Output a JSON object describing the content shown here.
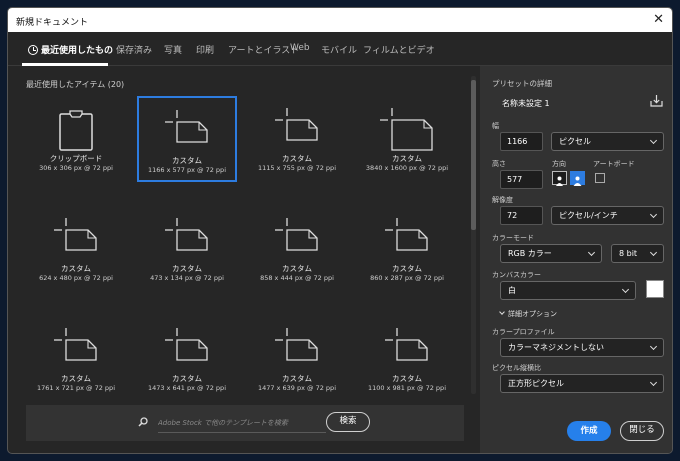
{
  "window": {
    "title": "新規ドキュメント",
    "close": "✕"
  },
  "tabs": [
    {
      "label": "最近使用したもの"
    },
    {
      "label": "保存済み"
    },
    {
      "label": "写真"
    },
    {
      "label": "印刷"
    },
    {
      "label": "アートとイラスト"
    },
    {
      "label": "Web"
    },
    {
      "label": "モバイル"
    },
    {
      "label": "フィルムとビデオ"
    }
  ],
  "recent": {
    "title": "最近使用したアイテム (20)",
    "items": [
      {
        "name": "クリップボード",
        "size": "306 x 306 px @ 72 ppi",
        "icon": "clipboard-icon"
      },
      {
        "name": "カスタム",
        "size": "1166 x 577 px @ 72 ppi",
        "icon": "custom-doc-icon"
      },
      {
        "name": "カスタム",
        "size": "1115 x 755 px @ 72 ppi",
        "icon": "custom-doc-icon"
      },
      {
        "name": "カスタム",
        "size": "3840 x 1600 px @ 72 ppi",
        "icon": "custom-doc-icon"
      },
      {
        "name": "カスタム",
        "size": "624 x 480 px @ 72 ppi",
        "icon": "custom-doc-icon"
      },
      {
        "name": "カスタム",
        "size": "473 x 134 px @ 72 ppi",
        "icon": "custom-doc-icon"
      },
      {
        "name": "カスタム",
        "size": "858 x 444 px @ 72 ppi",
        "icon": "custom-doc-icon"
      },
      {
        "name": "カスタム",
        "size": "860 x 287 px @ 72 ppi",
        "icon": "custom-doc-icon"
      },
      {
        "name": "カスタム",
        "size": "1761 x 721 px @ 72 ppi",
        "icon": "custom-doc-icon"
      },
      {
        "name": "カスタム",
        "size": "1473 x 641 px @ 72 ppi",
        "icon": "custom-doc-icon"
      },
      {
        "name": "カスタム",
        "size": "1477 x 639 px @ 72 ppi",
        "icon": "custom-doc-icon"
      },
      {
        "name": "カスタム",
        "size": "1100 x 981 px @ 72 ppi",
        "icon": "custom-doc-icon"
      }
    ]
  },
  "search": {
    "placeholder": "Adobe Stock で他のテンプレートを検索",
    "button": "検索"
  },
  "details": {
    "section_title": "プリセットの詳細",
    "doc_name": "名称未設定 1",
    "width_label": "幅",
    "width_value": "1166",
    "unit": "ピクセル",
    "height_label": "高さ",
    "height_value": "577",
    "orientation_label": "方向",
    "artboard_label": "アートボード",
    "resolution_label": "解像度",
    "resolution_value": "72",
    "resolution_unit": "ピクセル/インチ",
    "color_mode_label": "カラーモード",
    "color_mode": "RGB カラー",
    "bit_depth": "8 bit",
    "canvas_color_label": "カンバスカラー",
    "canvas_color": "白",
    "advanced_label": "詳細オプション",
    "color_profile_label": "カラープロファイル",
    "color_profile": "カラーマネジメントしない",
    "pixel_aspect_label": "ピクセル縦横比",
    "pixel_aspect": "正方形ピクセル",
    "create_button": "作成",
    "close_button": "閉じる"
  },
  "colors": {
    "accent": "#2680eb",
    "panel": "#323232",
    "background": "#262626"
  }
}
